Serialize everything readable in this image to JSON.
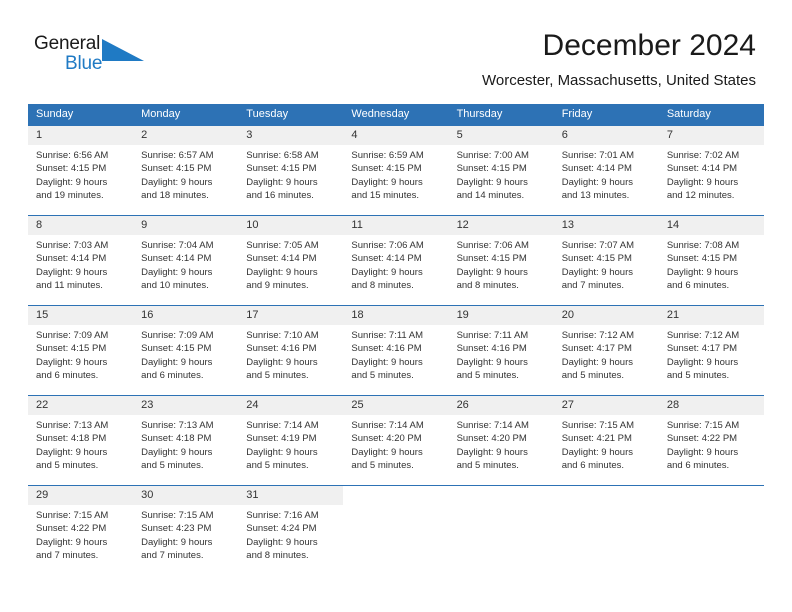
{
  "logo": {
    "word_general": "General",
    "word_blue": "Blue",
    "triangle_color": "#1f7ac4"
  },
  "header": {
    "title": "December 2024",
    "subtitle": "Worcester, Massachusetts, United States"
  },
  "theme": {
    "header_blue": "#2d72b5",
    "day_band_gray": "#f0f0f0",
    "text": "#333333",
    "background": "#ffffff"
  },
  "weekday_headers": [
    "Sunday",
    "Monday",
    "Tuesday",
    "Wednesday",
    "Thursday",
    "Friday",
    "Saturday"
  ],
  "weeks": [
    [
      {
        "day": "1",
        "sunrise": "Sunrise: 6:56 AM",
        "sunset": "Sunset: 4:15 PM",
        "daylight_line1": "Daylight: 9 hours",
        "daylight_line2": "and 19 minutes."
      },
      {
        "day": "2",
        "sunrise": "Sunrise: 6:57 AM",
        "sunset": "Sunset: 4:15 PM",
        "daylight_line1": "Daylight: 9 hours",
        "daylight_line2": "and 18 minutes."
      },
      {
        "day": "3",
        "sunrise": "Sunrise: 6:58 AM",
        "sunset": "Sunset: 4:15 PM",
        "daylight_line1": "Daylight: 9 hours",
        "daylight_line2": "and 16 minutes."
      },
      {
        "day": "4",
        "sunrise": "Sunrise: 6:59 AM",
        "sunset": "Sunset: 4:15 PM",
        "daylight_line1": "Daylight: 9 hours",
        "daylight_line2": "and 15 minutes."
      },
      {
        "day": "5",
        "sunrise": "Sunrise: 7:00 AM",
        "sunset": "Sunset: 4:15 PM",
        "daylight_line1": "Daylight: 9 hours",
        "daylight_line2": "and 14 minutes."
      },
      {
        "day": "6",
        "sunrise": "Sunrise: 7:01 AM",
        "sunset": "Sunset: 4:14 PM",
        "daylight_line1": "Daylight: 9 hours",
        "daylight_line2": "and 13 minutes."
      },
      {
        "day": "7",
        "sunrise": "Sunrise: 7:02 AM",
        "sunset": "Sunset: 4:14 PM",
        "daylight_line1": "Daylight: 9 hours",
        "daylight_line2": "and 12 minutes."
      }
    ],
    [
      {
        "day": "8",
        "sunrise": "Sunrise: 7:03 AM",
        "sunset": "Sunset: 4:14 PM",
        "daylight_line1": "Daylight: 9 hours",
        "daylight_line2": "and 11 minutes."
      },
      {
        "day": "9",
        "sunrise": "Sunrise: 7:04 AM",
        "sunset": "Sunset: 4:14 PM",
        "daylight_line1": "Daylight: 9 hours",
        "daylight_line2": "and 10 minutes."
      },
      {
        "day": "10",
        "sunrise": "Sunrise: 7:05 AM",
        "sunset": "Sunset: 4:14 PM",
        "daylight_line1": "Daylight: 9 hours",
        "daylight_line2": "and 9 minutes."
      },
      {
        "day": "11",
        "sunrise": "Sunrise: 7:06 AM",
        "sunset": "Sunset: 4:14 PM",
        "daylight_line1": "Daylight: 9 hours",
        "daylight_line2": "and 8 minutes."
      },
      {
        "day": "12",
        "sunrise": "Sunrise: 7:06 AM",
        "sunset": "Sunset: 4:15 PM",
        "daylight_line1": "Daylight: 9 hours",
        "daylight_line2": "and 8 minutes."
      },
      {
        "day": "13",
        "sunrise": "Sunrise: 7:07 AM",
        "sunset": "Sunset: 4:15 PM",
        "daylight_line1": "Daylight: 9 hours",
        "daylight_line2": "and 7 minutes."
      },
      {
        "day": "14",
        "sunrise": "Sunrise: 7:08 AM",
        "sunset": "Sunset: 4:15 PM",
        "daylight_line1": "Daylight: 9 hours",
        "daylight_line2": "and 6 minutes."
      }
    ],
    [
      {
        "day": "15",
        "sunrise": "Sunrise: 7:09 AM",
        "sunset": "Sunset: 4:15 PM",
        "daylight_line1": "Daylight: 9 hours",
        "daylight_line2": "and 6 minutes."
      },
      {
        "day": "16",
        "sunrise": "Sunrise: 7:09 AM",
        "sunset": "Sunset: 4:15 PM",
        "daylight_line1": "Daylight: 9 hours",
        "daylight_line2": "and 6 minutes."
      },
      {
        "day": "17",
        "sunrise": "Sunrise: 7:10 AM",
        "sunset": "Sunset: 4:16 PM",
        "daylight_line1": "Daylight: 9 hours",
        "daylight_line2": "and 5 minutes."
      },
      {
        "day": "18",
        "sunrise": "Sunrise: 7:11 AM",
        "sunset": "Sunset: 4:16 PM",
        "daylight_line1": "Daylight: 9 hours",
        "daylight_line2": "and 5 minutes."
      },
      {
        "day": "19",
        "sunrise": "Sunrise: 7:11 AM",
        "sunset": "Sunset: 4:16 PM",
        "daylight_line1": "Daylight: 9 hours",
        "daylight_line2": "and 5 minutes."
      },
      {
        "day": "20",
        "sunrise": "Sunrise: 7:12 AM",
        "sunset": "Sunset: 4:17 PM",
        "daylight_line1": "Daylight: 9 hours",
        "daylight_line2": "and 5 minutes."
      },
      {
        "day": "21",
        "sunrise": "Sunrise: 7:12 AM",
        "sunset": "Sunset: 4:17 PM",
        "daylight_line1": "Daylight: 9 hours",
        "daylight_line2": "and 5 minutes."
      }
    ],
    [
      {
        "day": "22",
        "sunrise": "Sunrise: 7:13 AM",
        "sunset": "Sunset: 4:18 PM",
        "daylight_line1": "Daylight: 9 hours",
        "daylight_line2": "and 5 minutes."
      },
      {
        "day": "23",
        "sunrise": "Sunrise: 7:13 AM",
        "sunset": "Sunset: 4:18 PM",
        "daylight_line1": "Daylight: 9 hours",
        "daylight_line2": "and 5 minutes."
      },
      {
        "day": "24",
        "sunrise": "Sunrise: 7:14 AM",
        "sunset": "Sunset: 4:19 PM",
        "daylight_line1": "Daylight: 9 hours",
        "daylight_line2": "and 5 minutes."
      },
      {
        "day": "25",
        "sunrise": "Sunrise: 7:14 AM",
        "sunset": "Sunset: 4:20 PM",
        "daylight_line1": "Daylight: 9 hours",
        "daylight_line2": "and 5 minutes."
      },
      {
        "day": "26",
        "sunrise": "Sunrise: 7:14 AM",
        "sunset": "Sunset: 4:20 PM",
        "daylight_line1": "Daylight: 9 hours",
        "daylight_line2": "and 5 minutes."
      },
      {
        "day": "27",
        "sunrise": "Sunrise: 7:15 AM",
        "sunset": "Sunset: 4:21 PM",
        "daylight_line1": "Daylight: 9 hours",
        "daylight_line2": "and 6 minutes."
      },
      {
        "day": "28",
        "sunrise": "Sunrise: 7:15 AM",
        "sunset": "Sunset: 4:22 PM",
        "daylight_line1": "Daylight: 9 hours",
        "daylight_line2": "and 6 minutes."
      }
    ],
    [
      {
        "day": "29",
        "sunrise": "Sunrise: 7:15 AM",
        "sunset": "Sunset: 4:22 PM",
        "daylight_line1": "Daylight: 9 hours",
        "daylight_line2": "and 7 minutes."
      },
      {
        "day": "30",
        "sunrise": "Sunrise: 7:15 AM",
        "sunset": "Sunset: 4:23 PM",
        "daylight_line1": "Daylight: 9 hours",
        "daylight_line2": "and 7 minutes."
      },
      {
        "day": "31",
        "sunrise": "Sunrise: 7:16 AM",
        "sunset": "Sunset: 4:24 PM",
        "daylight_line1": "Daylight: 9 hours",
        "daylight_line2": "and 8 minutes."
      },
      {
        "day": "",
        "sunrise": "",
        "sunset": "",
        "daylight_line1": "",
        "daylight_line2": ""
      },
      {
        "day": "",
        "sunrise": "",
        "sunset": "",
        "daylight_line1": "",
        "daylight_line2": ""
      },
      {
        "day": "",
        "sunrise": "",
        "sunset": "",
        "daylight_line1": "",
        "daylight_line2": ""
      },
      {
        "day": "",
        "sunrise": "",
        "sunset": "",
        "daylight_line1": "",
        "daylight_line2": ""
      }
    ]
  ]
}
